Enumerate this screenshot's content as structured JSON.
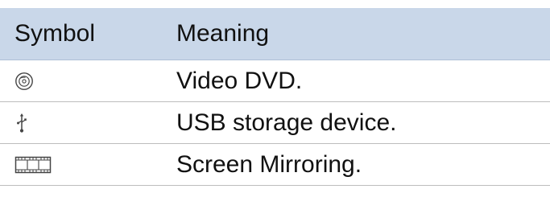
{
  "table": {
    "header": {
      "symbol": "Symbol",
      "meaning": "Meaning"
    },
    "rows": [
      {
        "icon": "dvd-disc-icon",
        "meaning": "Video DVD."
      },
      {
        "icon": "usb-icon",
        "meaning": "USB storage device."
      },
      {
        "icon": "film-strip-icon",
        "meaning": "Screen Mirroring."
      }
    ]
  },
  "colors": {
    "header_background": "#c9d7e9",
    "divider": "#bdbdbd",
    "text": "#111111"
  }
}
